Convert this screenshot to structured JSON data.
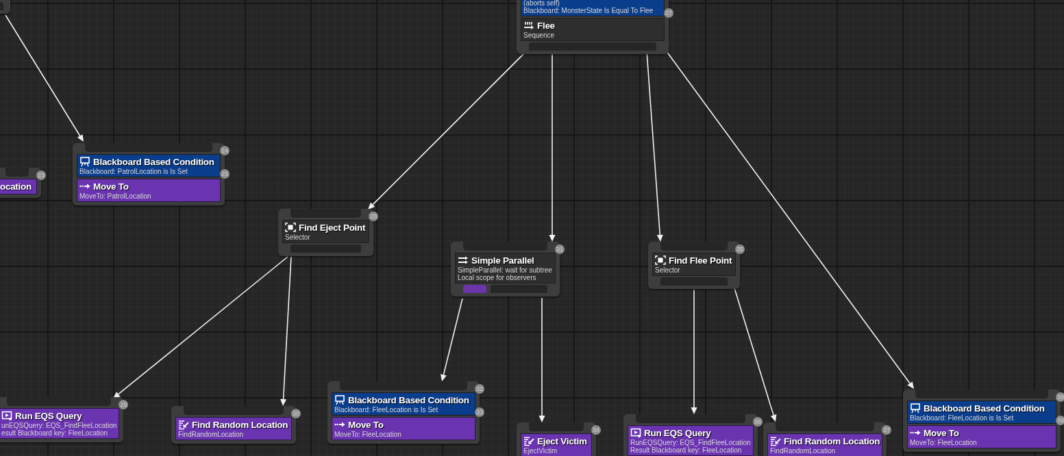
{
  "graph": {
    "nodes": [
      {
        "children": [
          {
            "badge": "24",
            "decorators": [
              {
                "kind": "blackboard",
                "title": "Blackboard Based Condition",
                "detail": [
                  "Blackboard: PatrolLocation is Is Set"
                ],
                "badge": "25"
              }
            ],
            "main": {
              "kind": "move_to",
              "title": "Move To",
              "detail": [
                "MoveTo: PatrolLocation"
              ]
            }
          }
        ]
      },
      {
        "badge": "23",
        "main": {
          "kind": "task",
          "title": "ocation"
        }
      },
      {
        "decorators": [
          {
            "kind": "blackboard",
            "detail": [
              "(aborts self)",
              "Blackboard: MonsterState Is Equal To Flee"
            ],
            "badge": "27"
          }
        ],
        "main": {
          "kind": "sequence",
          "title": "Flee",
          "detail": [
            "Sequence"
          ]
        },
        "children": [
          {
            "badge": "28",
            "main": {
              "kind": "selector",
              "title": "Find Eject Point",
              "detail": [
                "Selector"
              ]
            },
            "children": [
              {
                "badge": "29",
                "main": {
                  "kind": "eqs_query",
                  "title": "Run EQS Query",
                  "detail": [
                    "unEQSQuery: EQS_FindFleeLocation",
                    "esult Blackboard key: FleeLocation"
                  ]
                }
              },
              {
                "badge": "30",
                "main": {
                  "kind": "task",
                  "title": "Find Random Location",
                  "detail": [
                    "FindRandomLocation"
                  ]
                }
              }
            ]
          },
          {
            "badge": "31",
            "main": {
              "kind": "parallel",
              "title": "Simple Parallel",
              "detail": [
                "SimpleParallel: wait for subtree",
                "Local scope for observers"
              ]
            },
            "children": [
              {
                "badge": "32",
                "decorators": [
                  {
                    "kind": "blackboard",
                    "title": "Blackboard Based Condition",
                    "detail": [
                      "Blackboard: FleeLocation is Is Set"
                    ],
                    "badge": "33"
                  }
                ],
                "main": {
                  "kind": "move_to",
                  "title": "Move To",
                  "detail": [
                    "MoveTo: FleeLocation"
                  ]
                }
              },
              {
                "badge": "34",
                "main": {
                  "kind": "task",
                  "title": "Eject Victim",
                  "detail": [
                    "EjectVictim"
                  ]
                }
              }
            ]
          },
          {
            "badge": "35",
            "main": {
              "kind": "selector",
              "title": "Find Flee Point",
              "detail": [
                "Selector"
              ]
            },
            "children": [
              {
                "badge": "36",
                "main": {
                  "kind": "eqs_query",
                  "title": "Run EQS Query",
                  "detail": [
                    "RunEQSQuery: EQS_FindFleeLocation",
                    "Result Blackboard key: FleeLocation"
                  ]
                }
              },
              {
                "badge": "37",
                "main": {
                  "kind": "task",
                  "title": "Find Random Location",
                  "detail": [
                    "FindRandomLocation"
                  ]
                }
              }
            ]
          },
          {
            "badge": "38",
            "decorators": [
              {
                "kind": "blackboard",
                "title": "Blackboard Based Condition",
                "detail": [
                  "Blackboard: FleeLocation is Is Set"
                ],
                "badge": "39"
              }
            ],
            "main": {
              "kind": "move_to",
              "title": "Move To",
              "detail": [
                "MoveTo: FleeLocation"
              ]
            }
          }
        ]
      }
    ]
  }
}
